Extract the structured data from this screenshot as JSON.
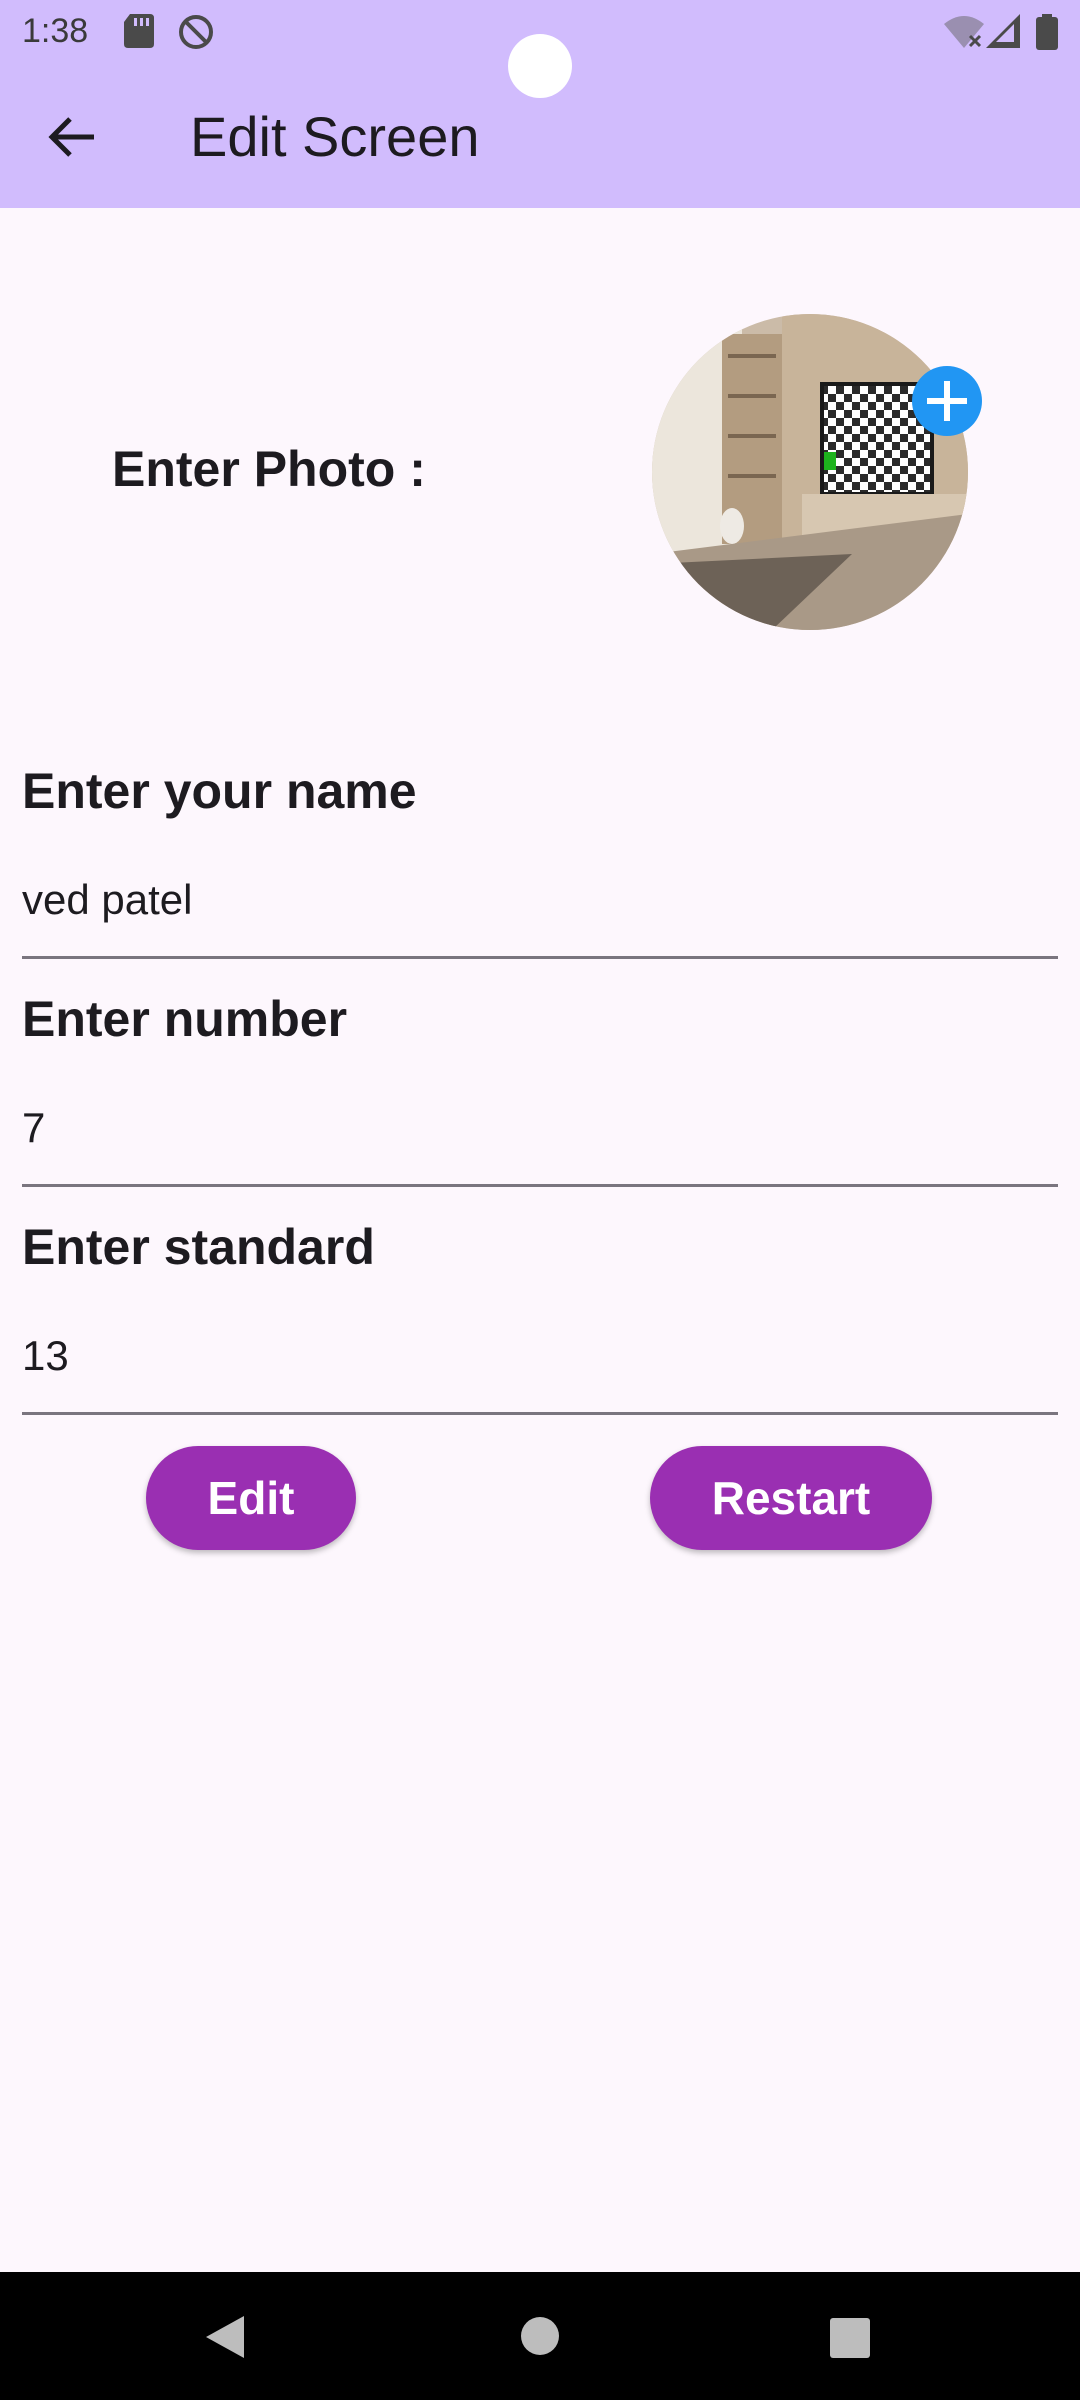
{
  "status_bar": {
    "time": "1:38",
    "icons": [
      "sd-card-icon",
      "do-not-disturb-icon",
      "wifi-off-icon",
      "signal-icon",
      "battery-icon"
    ]
  },
  "app_bar": {
    "title": "Edit Screen",
    "back_icon": "arrow-left-icon"
  },
  "photo": {
    "label": "Enter Photo :",
    "add_icon": "plus-icon"
  },
  "form": {
    "name": {
      "label": "Enter your name",
      "value": "ved patel"
    },
    "number": {
      "label": "Enter number",
      "value": "7"
    },
    "standard": {
      "label": "Enter standard",
      "value": "13"
    }
  },
  "buttons": {
    "edit": "Edit",
    "restart": "Restart"
  },
  "colors": {
    "app_bar": "#d1bcfd",
    "background": "#fdf7fd",
    "button": "#9a2fb2",
    "badge": "#2196f3"
  },
  "nav_bar": {
    "icons": [
      "back-triangle-icon",
      "home-circle-icon",
      "recents-square-icon"
    ]
  }
}
